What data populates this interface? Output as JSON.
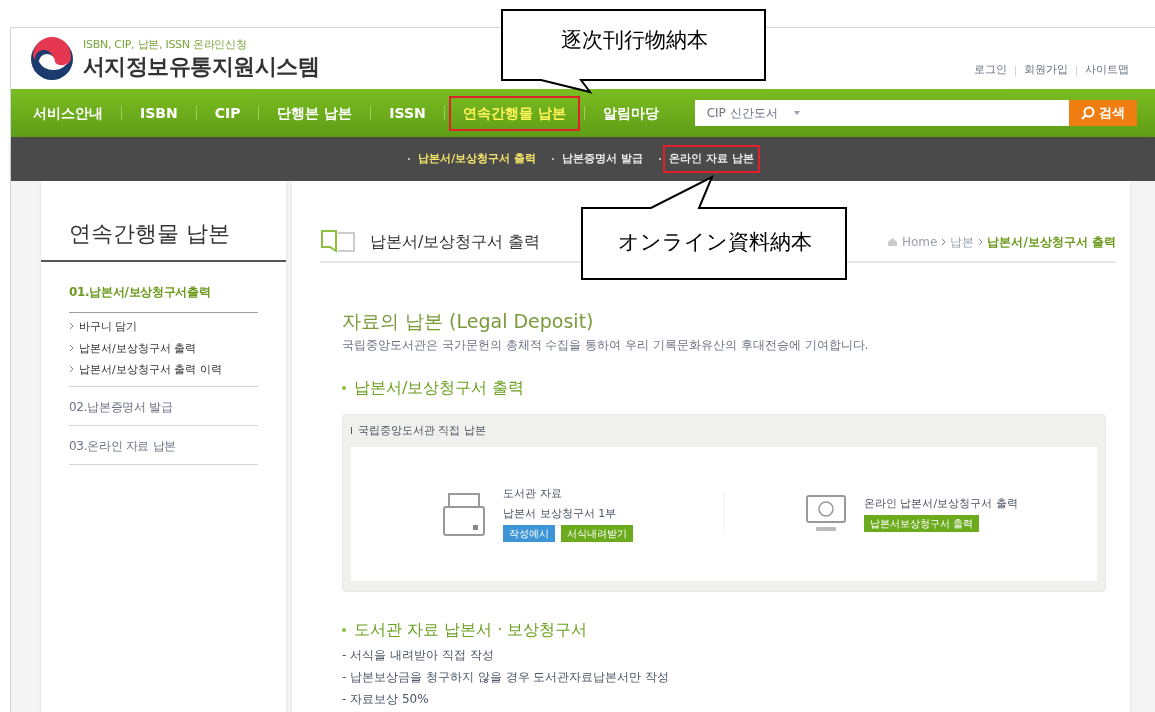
{
  "header": {
    "tagline": "ISBN, CIP, 납본, ISSN 온라인신청",
    "site_title": "서지정보유통지원시스템",
    "util_links": [
      "로그인",
      "회원가입",
      "사이트맵"
    ]
  },
  "nav": {
    "items": [
      {
        "label": "서비스안내",
        "selected": false,
        "highlighted": false
      },
      {
        "label": "ISBN",
        "selected": false,
        "highlighted": false
      },
      {
        "label": "CIP",
        "selected": false,
        "highlighted": false
      },
      {
        "label": "단행본 납본",
        "selected": false,
        "highlighted": false
      },
      {
        "label": "ISSN",
        "selected": false,
        "highlighted": false
      },
      {
        "label": "연속간행물 납본",
        "selected": true,
        "highlighted": true
      },
      {
        "label": "알림마당",
        "selected": false,
        "highlighted": false
      }
    ],
    "search": {
      "category": "CIP 신간도서",
      "button": "검색"
    }
  },
  "subnav": [
    {
      "label": "납본서/보상청구서 출력",
      "selected": true,
      "highlighted": false
    },
    {
      "label": "납본증명서 발급",
      "selected": false,
      "highlighted": false
    },
    {
      "label": "온라인 자료 납본",
      "selected": false,
      "highlighted": true
    }
  ],
  "callouts": [
    {
      "text": "逐次刊行物納本"
    },
    {
      "text": "オンライン資料納本"
    }
  ],
  "sidebar": {
    "title": "연속간행물 납본",
    "items": [
      {
        "label": "01.납본서/보상청구서출력",
        "selected": true,
        "children": [
          {
            "label": "바구니 담기"
          },
          {
            "label": "납본서/보상청구서 출력"
          },
          {
            "label": "납본서/보상청구서 출력 이력"
          }
        ]
      },
      {
        "label": "02.납본증명서 발급",
        "selected": false
      },
      {
        "label": "03.온라인 자료 납본",
        "selected": false
      }
    ]
  },
  "content": {
    "page_title": "납본서/보상청구서 출력",
    "breadcrumb": [
      {
        "label": "Home",
        "current": false
      },
      {
        "label": "납본",
        "current": false
      },
      {
        "label": "납본서/보상청구서 출력",
        "current": true
      }
    ],
    "heading": "자료의 납본 (Legal Deposit)",
    "intro": "국립중앙도서관은 국가문헌의 총체적 수집을 통하여 우리 기록문화유산의 후대전승에 기여합니다.",
    "section1": "납본서/보상청구서 출력",
    "panel": {
      "title": "국립중앙도서관 직접 납본",
      "options": [
        {
          "kind": "folder",
          "lines": [
            "도서관 자료",
            "납본서 보상청구서 1부"
          ],
          "buttons": [
            {
              "label": "작성예시",
              "color": "#3e95d6"
            },
            {
              "label": "서식내려받기",
              "color": "#6cab1e"
            }
          ]
        },
        {
          "kind": "monitor",
          "lines": [
            "온라인 납본서/보상청구서 출력"
          ],
          "buttons": [
            {
              "label": "납본서보상청구서 출력",
              "color": "#6cab1e"
            }
          ]
        }
      ]
    },
    "section2": "도서관 자료 납본서 · 보상청구서",
    "notes": [
      "- 서식을 내려받아 직접 작성",
      "- 납본보상금을 청구하지 않을 경우 도서관자료납본서만 작성",
      "- 자료보상 50%"
    ]
  }
}
